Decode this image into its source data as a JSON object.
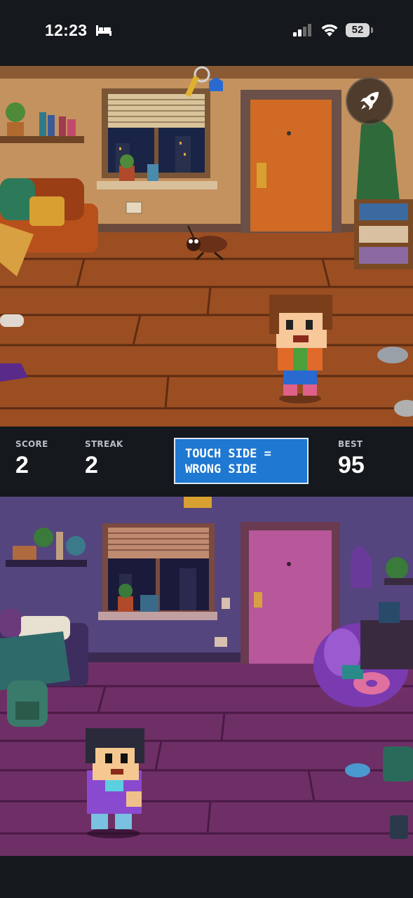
{
  "status_bar": {
    "time": "12:23",
    "battery": "52",
    "icons": [
      "bed-icon",
      "cellular-signal-icon",
      "wifi-icon",
      "battery-icon"
    ]
  },
  "game": {
    "rocket_button_icon": "rocket-icon",
    "top_room": {
      "theme": "orange",
      "characters": [
        "player-boy",
        "cockroach",
        "keys"
      ]
    },
    "bottom_room": {
      "theme": "purple",
      "characters": [
        "player-mirror-boy"
      ]
    }
  },
  "hud": {
    "score_label": "SCORE",
    "score_value": "2",
    "streak_label": "STREAK",
    "streak_value": "2",
    "hint_text": "TOUCH SIDE =\nWRONG SIDE",
    "best_label": "BEST",
    "best_value": "95"
  },
  "colors": {
    "background": "#15181c",
    "hint_box": "#1f78d1",
    "top_wall": "#c99a6c",
    "top_floor": "#a4582a",
    "bottom_wall": "#5e4b8e",
    "bottom_floor": "#7a3a72"
  }
}
